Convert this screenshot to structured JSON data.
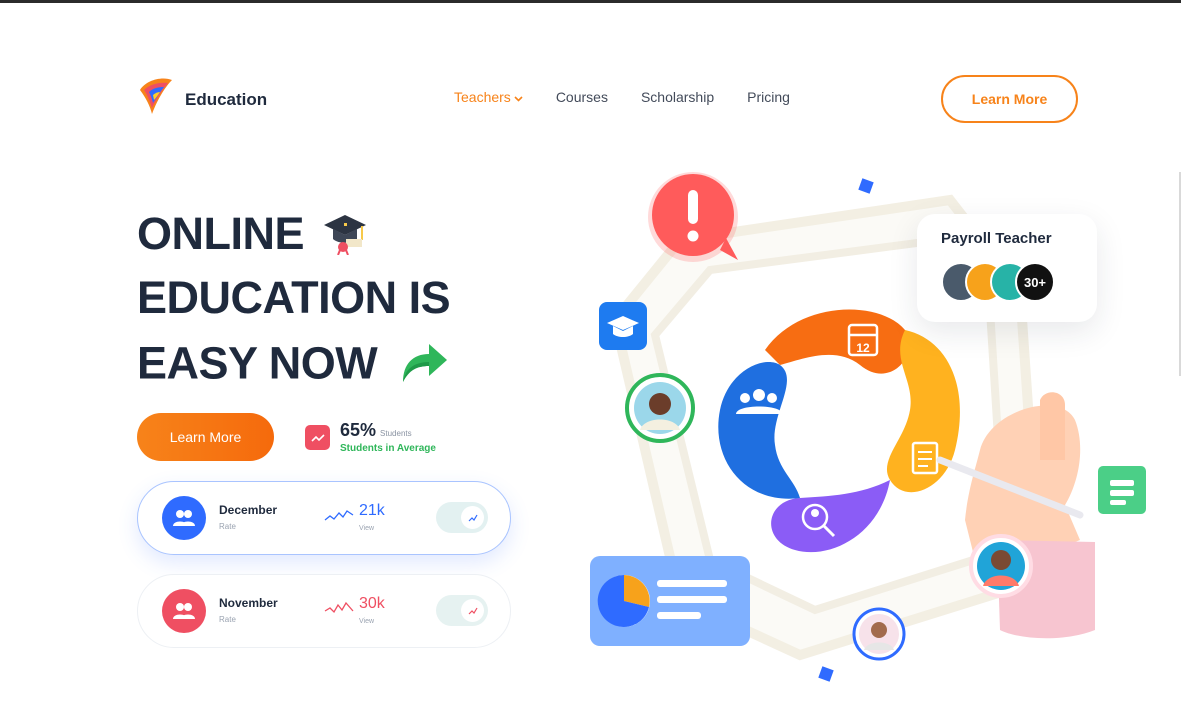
{
  "brand": {
    "name": "Education"
  },
  "nav": {
    "items": [
      "Teachers",
      "Courses",
      "Scholarship",
      "Pricing"
    ]
  },
  "header": {
    "cta_label": "Learn More"
  },
  "hero": {
    "lines": [
      "ONLINE",
      "EDUCATION IS",
      "EASY NOW"
    ],
    "cta_label": "Learn More",
    "stat": {
      "percent": "65%",
      "small": "Students",
      "sub": "Students in Average"
    }
  },
  "cards": [
    {
      "title": "December",
      "subtitle": "Rate",
      "value": "21k",
      "value_label": "View",
      "accent": "#2f6bff"
    },
    {
      "title": "November",
      "subtitle": "Rate",
      "value": "30k",
      "value_label": "View",
      "accent": "#ef4f62"
    }
  ],
  "payroll": {
    "title": "Payroll Teacher",
    "more_count": "30+"
  },
  "calendar": {
    "day": "12"
  },
  "colors": {
    "orange": "#f7831a",
    "navy": "#1f2a3d",
    "green": "#2fb65a",
    "blue": "#2f6bff",
    "red": "#ef4f62"
  }
}
